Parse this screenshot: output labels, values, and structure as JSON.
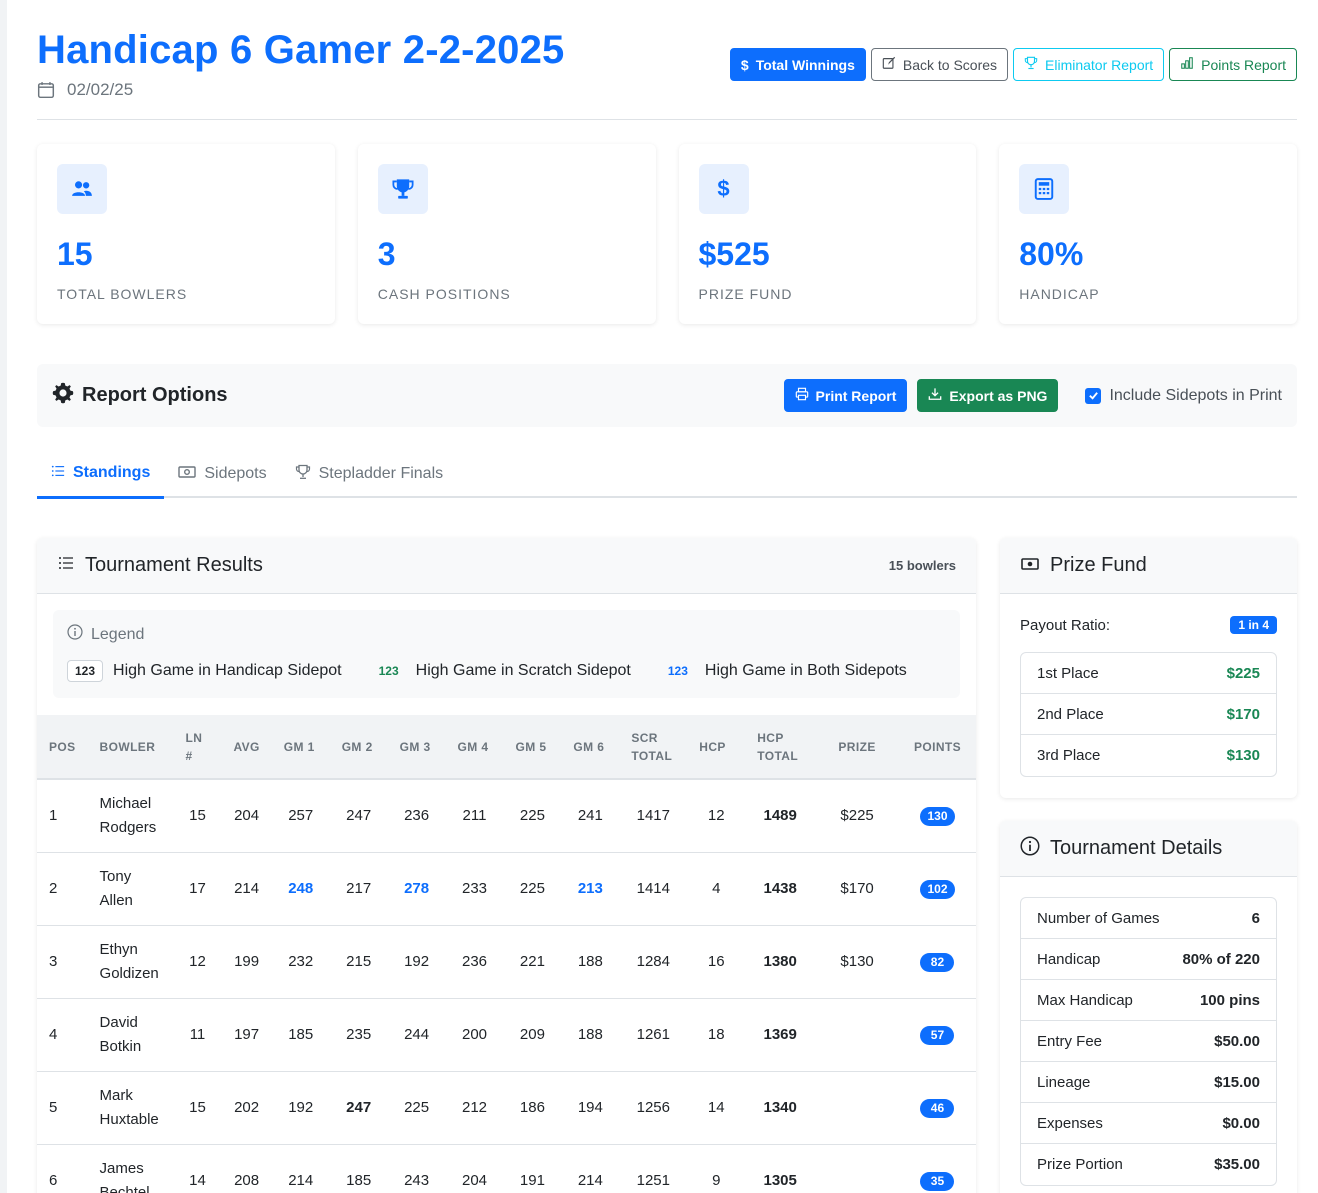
{
  "header": {
    "title": "Handicap 6 Gamer 2-2-2025",
    "date": "02/02/25",
    "buttons": {
      "total_winnings": "Total Winnings",
      "back_to_scores": "Back to Scores",
      "eliminator_report": "Eliminator Report",
      "points_report": "Points Report"
    }
  },
  "stats": [
    {
      "icon": "users-icon",
      "value": "15",
      "label": "TOTAL BOWLERS"
    },
    {
      "icon": "trophy-icon",
      "value": "3",
      "label": "CASH POSITIONS"
    },
    {
      "icon": "dollar-icon",
      "value": "$525",
      "label": "PRIZE FUND"
    },
    {
      "icon": "calculator-icon",
      "value": "80%",
      "label": "HANDICAP"
    }
  ],
  "report_options": {
    "title": "Report Options",
    "print_label": "Print Report",
    "export_label": "Export as PNG",
    "include_sidepots_label": "Include Sidepots in Print",
    "include_sidepots_checked": true
  },
  "tabs": [
    {
      "label": "Standings",
      "active": true
    },
    {
      "label": "Sidepots",
      "active": false
    },
    {
      "label": "Stepladder Finals",
      "active": false
    }
  ],
  "results": {
    "title": "Tournament Results",
    "count": "15 bowlers",
    "legend": {
      "title": "Legend",
      "sample": "123",
      "handicap": "High Game in Handicap Sidepot",
      "scratch": "High Game in Scratch Sidepot",
      "both": "High Game in Both Sidepots"
    },
    "columns": [
      "POS",
      "BOWLER",
      "LN #",
      "AVG",
      "GM 1",
      "GM 2",
      "GM 3",
      "GM 4",
      "GM 5",
      "GM 6",
      "SCR TOTAL",
      "HCP",
      "HCP TOTAL",
      "PRIZE",
      "POINTS"
    ],
    "rows": [
      {
        "pos": "1",
        "first": "Michael",
        "last": "Rodgers",
        "ln": "15",
        "avg": "204",
        "games": [
          "257",
          "247",
          "236",
          "211",
          "225",
          "241"
        ],
        "highlights": [
          "",
          "",
          "",
          "",
          "",
          ""
        ],
        "scr": "1417",
        "hcp": "12",
        "hcp_total": "1489",
        "prize": "$225",
        "points": "130"
      },
      {
        "pos": "2",
        "first": "Tony",
        "last": "Allen",
        "ln": "17",
        "avg": "214",
        "games": [
          "248",
          "217",
          "278",
          "233",
          "225",
          "213"
        ],
        "highlights": [
          "both",
          "",
          "both",
          "",
          "",
          "both"
        ],
        "scr": "1414",
        "hcp": "4",
        "hcp_total": "1438",
        "prize": "$170",
        "points": "102"
      },
      {
        "pos": "3",
        "first": "Ethyn",
        "last": "Goldizen",
        "ln": "12",
        "avg": "199",
        "games": [
          "232",
          "215",
          "192",
          "236",
          "221",
          "188"
        ],
        "highlights": [
          "",
          "",
          "",
          "",
          "",
          ""
        ],
        "scr": "1284",
        "hcp": "16",
        "hcp_total": "1380",
        "prize": "$130",
        "points": "82"
      },
      {
        "pos": "4",
        "first": "David",
        "last": "Botkin",
        "ln": "11",
        "avg": "197",
        "games": [
          "185",
          "235",
          "244",
          "200",
          "209",
          "188"
        ],
        "highlights": [
          "",
          "",
          "",
          "",
          "",
          ""
        ],
        "scr": "1261",
        "hcp": "18",
        "hcp_total": "1369",
        "prize": "",
        "points": "57"
      },
      {
        "pos": "5",
        "first": "Mark",
        "last": "Huxtable",
        "ln": "15",
        "avg": "202",
        "games": [
          "192",
          "247",
          "225",
          "212",
          "186",
          "194"
        ],
        "highlights": [
          "",
          "handicap",
          "",
          "",
          "",
          ""
        ],
        "scr": "1256",
        "hcp": "14",
        "hcp_total": "1340",
        "prize": "",
        "points": "46"
      },
      {
        "pos": "6",
        "first": "James",
        "last": "Bechtel",
        "ln": "14",
        "avg": "208",
        "games": [
          "214",
          "185",
          "243",
          "204",
          "191",
          "214"
        ],
        "highlights": [
          "",
          "",
          "",
          "",
          "",
          ""
        ],
        "scr": "1251",
        "hcp": "9",
        "hcp_total": "1305",
        "prize": "",
        "points": "35"
      }
    ]
  },
  "prize_fund": {
    "title": "Prize Fund",
    "payout_label": "Payout Ratio:",
    "payout_value": "1 in 4",
    "places": [
      {
        "label": "1st Place",
        "value": "$225"
      },
      {
        "label": "2nd Place",
        "value": "$170"
      },
      {
        "label": "3rd Place",
        "value": "$130"
      }
    ]
  },
  "details": {
    "title": "Tournament Details",
    "rows": [
      {
        "label": "Number of Games",
        "value": "6"
      },
      {
        "label": "Handicap",
        "value": "80% of 220"
      },
      {
        "label": "Max Handicap",
        "value": "100 pins"
      },
      {
        "label": "Entry Fee",
        "value": "$50.00"
      },
      {
        "label": "Lineage",
        "value": "$15.00"
      },
      {
        "label": "Expenses",
        "value": "$0.00"
      },
      {
        "label": "Prize Portion",
        "value": "$35.00"
      }
    ]
  },
  "colors": {
    "primary": "#0d6efd",
    "success": "#198754",
    "info": "#0dcaf0",
    "muted": "#6c757d"
  }
}
